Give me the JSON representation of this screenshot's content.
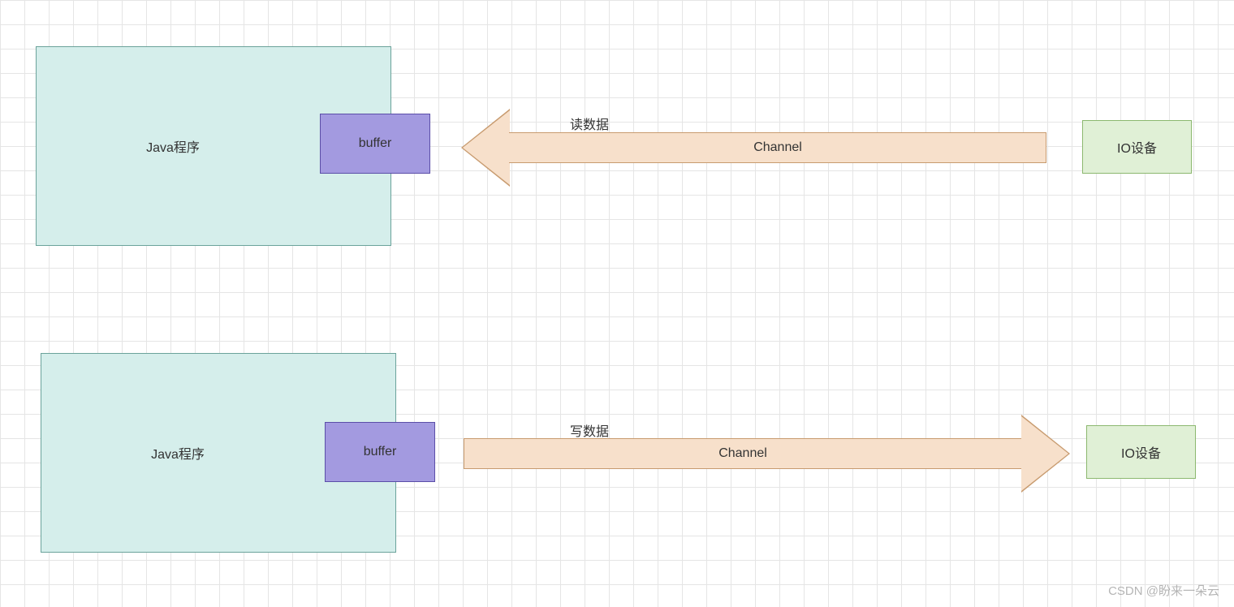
{
  "top": {
    "java_label": "Java程序",
    "buffer_label": "buffer",
    "arrow_label": "Channel",
    "direction_label": "读数据",
    "io_label": "IO设备"
  },
  "bottom": {
    "java_label": "Java程序",
    "buffer_label": "buffer",
    "arrow_label": "Channel",
    "direction_label": "写数据",
    "io_label": "IO设备"
  },
  "watermark": "CSDN @盼来一朵云",
  "colors": {
    "java_fill": "#d5eeeb",
    "java_border": "#6ba39b",
    "buffer_fill": "#a39ae0",
    "buffer_border": "#5b4ea8",
    "arrow_fill": "#f7e0cb",
    "arrow_border": "#c89b6f",
    "io_fill": "#e0f0d6",
    "io_border": "#8cb86f"
  }
}
